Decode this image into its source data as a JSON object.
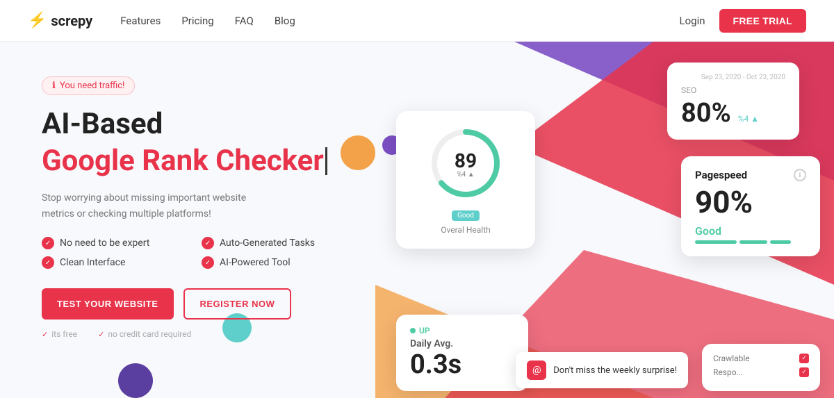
{
  "nav": {
    "logo_text": "screpy",
    "links": [
      "Features",
      "Pricing",
      "FAQ",
      "Blog"
    ],
    "login_label": "Login",
    "free_trial_label": "FREE TRIAL"
  },
  "hero": {
    "badge": "You need traffic!",
    "title_line1": "AI-Based",
    "title_line2": "Google Rank Checker",
    "description": "Stop worrying about missing important website metrics or checking multiple platforms!",
    "features": [
      "No need to be expert",
      "Auto-Generated Tasks",
      "Clean Interface",
      "AI-Powered Tool"
    ],
    "btn_test": "TEST YOUR WEBSITE",
    "btn_register": "REGISTER NOW",
    "note1": "its free",
    "note2": "no credit card required"
  },
  "cards": {
    "date_range": "Sep 23, 2020 - Oct 23, 2020",
    "seo": {
      "label": "SEO",
      "value": "80%",
      "change": "%4 ▲"
    },
    "health": {
      "score": "89",
      "sub": "%4 ▲",
      "badge": "Good",
      "label": "Overal Health"
    },
    "pagespeed": {
      "label": "Pagespeed",
      "value": "90%",
      "status": "Good"
    },
    "daily": {
      "status": "UP",
      "label": "Daily Avg.",
      "value": "0.3s"
    },
    "crawlable": {
      "label": "Crawlable",
      "rows": [
        "Crawlable",
        "Respo..."
      ]
    },
    "toast": "Don't miss the weekly surprise!"
  },
  "colors": {
    "primary": "#e8334a",
    "teal": "#4ecba5",
    "orange": "#f4a24a",
    "purple": "#7c4fc4"
  }
}
